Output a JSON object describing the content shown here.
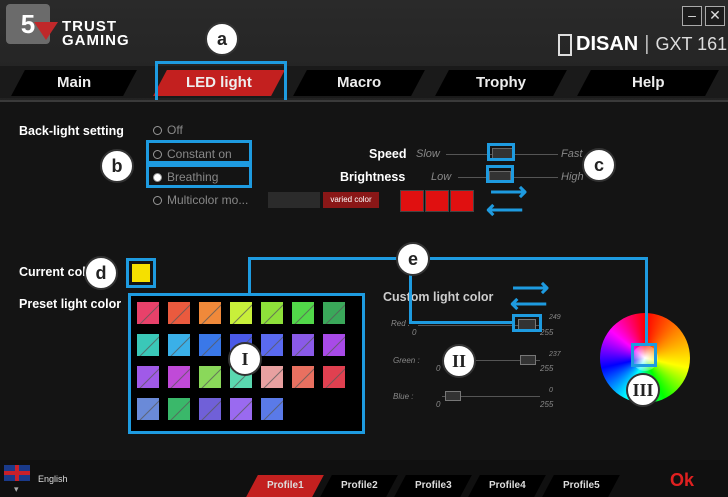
{
  "step_number": "5",
  "brand": {
    "line1": "TRUST",
    "line2": "GAMING"
  },
  "window": {
    "minimize": "–",
    "close": "✕"
  },
  "device": {
    "name": "DISAN",
    "separator": "|",
    "model": "GXT 161"
  },
  "tabs": [
    {
      "label": "Main"
    },
    {
      "label": "LED light"
    },
    {
      "label": "Macro"
    },
    {
      "label": "Trophy"
    },
    {
      "label": "Help"
    }
  ],
  "backlight": {
    "label": "Back-light setting",
    "options": [
      {
        "label": "Off",
        "checked": false
      },
      {
        "label": "Constant on",
        "checked": false
      },
      {
        "label": "Breathing",
        "checked": true
      },
      {
        "label": "Multicolor mo...",
        "checked": false
      }
    ],
    "varied_button": "varied color"
  },
  "speed": {
    "label": "Speed",
    "min": "Slow",
    "max": "Fast"
  },
  "brightness": {
    "label": "Brightness",
    "min": "Low",
    "max": "High"
  },
  "multicolor_swatches": [
    "#e01010",
    "#e01010",
    "#e01010"
  ],
  "current_color": {
    "label": "Current color",
    "color": "#f5e000"
  },
  "preset": {
    "label": "Preset light color",
    "colors": [
      "#e8416a",
      "#ea5a3e",
      "#f0893a",
      "#c8f03a",
      "#8ee03a",
      "#52d84a",
      "#3aa85a",
      "#3ac8b8",
      "#3ab0e8",
      "#3a78e8",
      "#4a5ae8",
      "#5a6af0",
      "#8a5ae8",
      "#a84ae8",
      "#a05ae8",
      "#c04ad8",
      "#8ad85a",
      "#5ad8b0",
      "#e8a0a0",
      "#e87060",
      "#e04050",
      "#6a8ad8",
      "#3ab86a",
      "#7060d8",
      "#9a6af0",
      "#5a7ae8"
    ]
  },
  "custom": {
    "label": "Custom light color",
    "channels": [
      {
        "name": "Red :",
        "min": "0",
        "max": "255",
        "value": "249"
      },
      {
        "name": "Green :",
        "min": "0",
        "max": "255",
        "value": "237"
      },
      {
        "name": "Blue :",
        "min": "0",
        "max": "255",
        "value": "0"
      }
    ]
  },
  "callouts": {
    "a": "a",
    "b": "b",
    "c": "c",
    "d": "d",
    "e": "e",
    "I": "I",
    "II": "II",
    "III": "III"
  },
  "language": "English",
  "profiles": [
    "Profile1",
    "Profile2",
    "Profile3",
    "Profile4",
    "Profile5"
  ],
  "ok_label": "Ok",
  "colors": {
    "accent": "#c3201f",
    "highlight": "#1e9be0"
  }
}
